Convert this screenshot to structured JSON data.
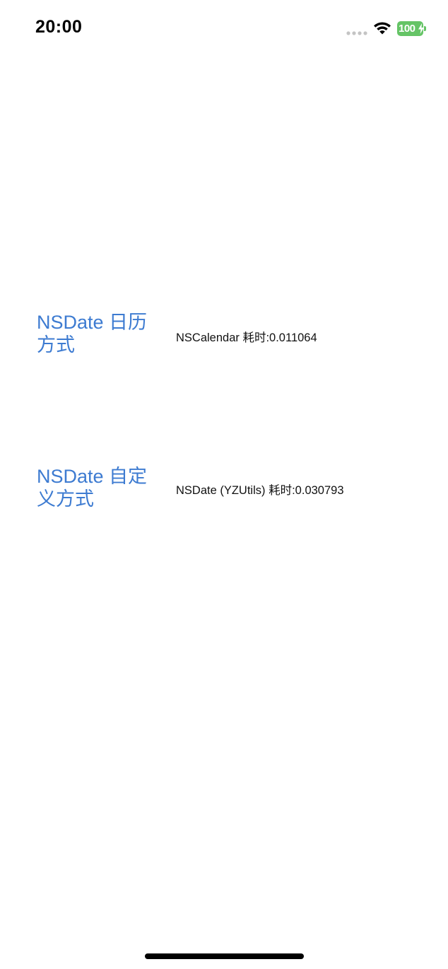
{
  "status_bar": {
    "time": "20:00",
    "battery_level": "100",
    "icons": [
      "signal-icon",
      "wifi-icon",
      "battery-icon",
      "charging-bolt-icon"
    ],
    "battery_color": "#65c466"
  },
  "rows": [
    {
      "button_label": "NSDate 日历方式",
      "result_text": "NSCalendar 耗时:0.011064"
    },
    {
      "button_label": "NSDate 自定义方式",
      "result_text": "NSDate (YZUtils) 耗时:0.030793"
    }
  ],
  "colors": {
    "accent": "#3d7bd1",
    "text": "#111111",
    "background": "#ffffff"
  }
}
